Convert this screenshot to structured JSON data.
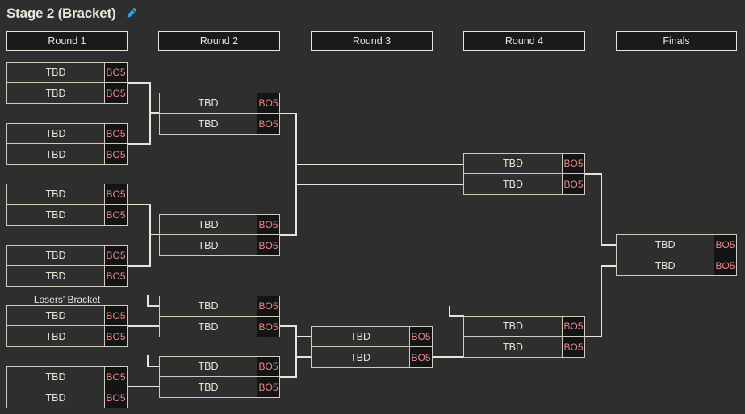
{
  "page": {
    "title": "Stage 2 (Bracket)",
    "edit_icon": "pencil-edit-icon",
    "background_color": "#2e2e2e",
    "line_color": "#e8e4d8",
    "text_color": "#e8e4d8",
    "format_badge_color": "#e8888a",
    "accent_color": "#35a0e8"
  },
  "rounds": [
    {
      "label": "Round 1"
    },
    {
      "label": "Round 2"
    },
    {
      "label": "Round 3"
    },
    {
      "label": "Round 4"
    },
    {
      "label": "Finals"
    }
  ],
  "section_labels": [
    {
      "label": "Losers' Bracket"
    }
  ],
  "matches": [
    {
      "id": "wb-r1-m1",
      "top": {
        "team": "TBD",
        "format": "BO5"
      },
      "bottom": {
        "team": "TBD",
        "format": "BO5"
      }
    },
    {
      "id": "wb-r1-m2",
      "top": {
        "team": "TBD",
        "format": "BO5"
      },
      "bottom": {
        "team": "TBD",
        "format": "BO5"
      }
    },
    {
      "id": "wb-r1-m3",
      "top": {
        "team": "TBD",
        "format": "BO5"
      },
      "bottom": {
        "team": "TBD",
        "format": "BO5"
      }
    },
    {
      "id": "wb-r1-m4",
      "top": {
        "team": "TBD",
        "format": "BO5"
      },
      "bottom": {
        "team": "TBD",
        "format": "BO5"
      }
    },
    {
      "id": "wb-r2-m1",
      "top": {
        "team": "TBD",
        "format": "BO5"
      },
      "bottom": {
        "team": "TBD",
        "format": "BO5"
      }
    },
    {
      "id": "wb-r2-m2",
      "top": {
        "team": "TBD",
        "format": "BO5"
      },
      "bottom": {
        "team": "TBD",
        "format": "BO5"
      }
    },
    {
      "id": "wb-r3-m1",
      "top": {
        "team": "TBD",
        "format": "BO5"
      },
      "bottom": {
        "team": "TBD",
        "format": "BO5"
      }
    },
    {
      "id": "finals-m1",
      "top": {
        "team": "TBD",
        "format": "BO5"
      },
      "bottom": {
        "team": "TBD",
        "format": "BO5"
      }
    },
    {
      "id": "lb-r1-m1",
      "top": {
        "team": "TBD",
        "format": "BO5"
      },
      "bottom": {
        "team": "TBD",
        "format": "BO5"
      }
    },
    {
      "id": "lb-r1-m2",
      "top": {
        "team": "TBD",
        "format": "BO5"
      },
      "bottom": {
        "team": "TBD",
        "format": "BO5"
      }
    },
    {
      "id": "lb-r2-m1",
      "top": {
        "team": "TBD",
        "format": "BO5"
      },
      "bottom": {
        "team": "TBD",
        "format": "BO5"
      }
    },
    {
      "id": "lb-r2-m2",
      "top": {
        "team": "TBD",
        "format": "BO5"
      },
      "bottom": {
        "team": "TBD",
        "format": "BO5"
      }
    },
    {
      "id": "lb-r3-m1",
      "top": {
        "team": "TBD",
        "format": "BO5"
      },
      "bottom": {
        "team": "TBD",
        "format": "BO5"
      }
    },
    {
      "id": "lb-r4-m1",
      "top": {
        "team": "TBD",
        "format": "BO5"
      },
      "bottom": {
        "team": "TBD",
        "format": "BO5"
      }
    }
  ]
}
